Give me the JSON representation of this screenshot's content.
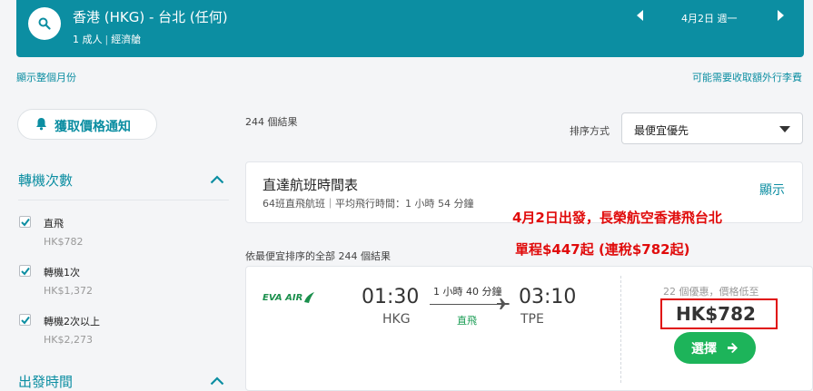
{
  "search": {
    "route": "香港 (HKG) - 台北 (任何)",
    "passengers": "1 成人",
    "cabin": "經濟艙",
    "date": "4月2日 週一",
    "prev_icon": "triangle-left",
    "next_icon": "triangle-right"
  },
  "links": {
    "show_month": "顯示整個月份",
    "extra_fees": "可能需要收取額外行李費"
  },
  "sidebar": {
    "price_alert": "獲取價格通知",
    "stops_title": "轉機次數",
    "stops": [
      {
        "label": "直飛",
        "price": "HK$782"
      },
      {
        "label": "轉機1次",
        "price": "HK$1,372"
      },
      {
        "label": "轉機2次以上",
        "price": "HK$2,273"
      }
    ],
    "depart_title": "出發時間"
  },
  "results": {
    "count": "244 個結果",
    "sort_label": "排序方式",
    "sort_value": "最便宜優先",
    "all_results": "依最便宜排序的全部 244 個結果"
  },
  "direct_schedule": {
    "title": "直達航班時間表",
    "subtitle": "64班直飛航班｜平均飛行時間：1 小時 54 分鐘",
    "show": "顯示"
  },
  "overlay": {
    "line1": "4月2日出發，長榮航空香港飛台北",
    "line2": "單程$447起 (連稅$782起)",
    "color": "#e00b0b"
  },
  "flight": {
    "airline": "EVA AIR",
    "depart_time": "01:30",
    "depart_code": "HKG",
    "duration": "1 小時 40 分鐘",
    "stops": "直飛",
    "arrive_time": "03:10",
    "arrive_code": "TPE",
    "deals": "22 個優惠，價格低至",
    "price": "HK$782",
    "select": "選擇"
  },
  "colors": {
    "brand": "#0c8ea2",
    "select_button": "#1db45a",
    "direct_tag": "#1a9c54"
  }
}
